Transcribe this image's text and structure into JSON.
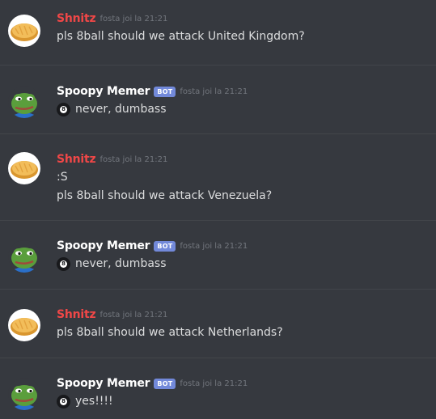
{
  "time_prefix": "fosta joi la",
  "bot_tag": "BOT",
  "ball_glyph": "8",
  "colors": {
    "background": "#36393f",
    "user_name": "#f04747",
    "bot_name": "#ffffff",
    "bot_tag": "#7289da",
    "timestamp": "#72767d",
    "message_text": "#dcddde"
  },
  "messages": [
    {
      "author": "Shnitz",
      "time": "fosta joi la 21:21",
      "avatar": "bread-avatar",
      "lines": [
        "pls 8ball should we attack United Kingdom?"
      ]
    },
    {
      "author": "Spoopy Memer",
      "tag": "BOT",
      "time": "fosta joi la 21:21",
      "avatar": "pepe-frog-avatar",
      "lines": [
        "never, dumbass"
      ]
    },
    {
      "author": "Shnitz",
      "time": "fosta joi la 21:21",
      "avatar": "bread-avatar",
      "lines": [
        ":S",
        "pls 8ball should we attack Venezuela?"
      ]
    },
    {
      "author": "Spoopy Memer",
      "tag": "BOT",
      "time": "fosta joi la 21:21",
      "avatar": "pepe-frog-avatar",
      "lines": [
        "never, dumbass"
      ]
    },
    {
      "author": "Shnitz",
      "time": "fosta joi la 21:21",
      "avatar": "bread-avatar",
      "lines": [
        "pls 8ball should we attack Netherlands?"
      ]
    },
    {
      "author": "Spoopy Memer",
      "tag": "BOT",
      "time": "fosta joi la 21:21",
      "avatar": "pepe-frog-avatar",
      "lines": [
        "yes!!!!"
      ]
    }
  ]
}
